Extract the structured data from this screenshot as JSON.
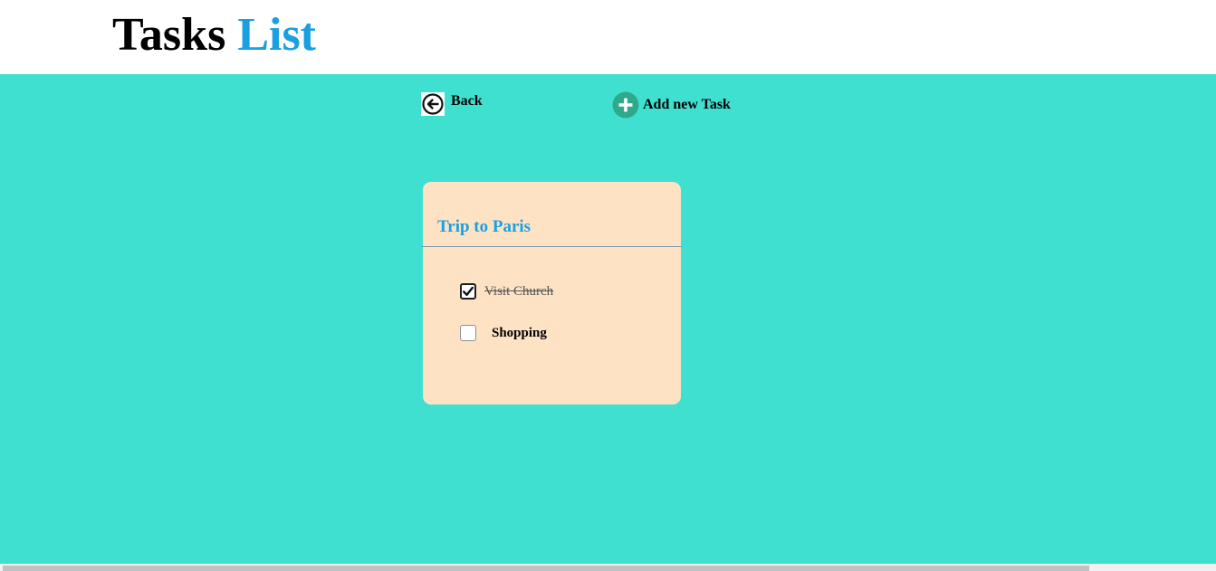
{
  "header": {
    "title_word1": "Tasks",
    "title_word2": "List"
  },
  "nav": {
    "back_label": "Back",
    "add_label": "Add new Task"
  },
  "card": {
    "title": "Trip to Paris",
    "tasks": [
      {
        "label": "Visit Church",
        "done": true
      },
      {
        "label": "Shopping",
        "done": false
      }
    ]
  },
  "colors": {
    "main_background": "#40e0d0",
    "accent": "#1a9fe0",
    "card_background": "#fde3c4",
    "add_icon": "#2ea98a"
  },
  "icons": {
    "back": "arrow-left-circle-icon",
    "add": "plus-circle-icon",
    "check": "check-icon"
  }
}
